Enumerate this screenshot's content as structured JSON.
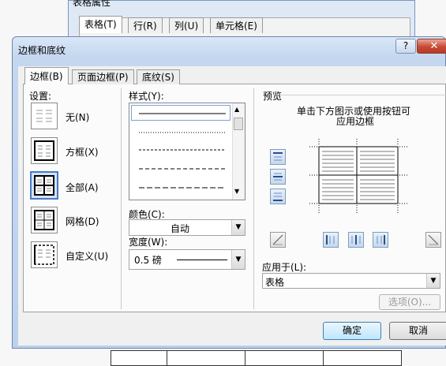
{
  "back_dialog": {
    "title": "表格属性",
    "tabs": [
      "表格(T)",
      "行(R)",
      "列(U)",
      "单元格(E)"
    ]
  },
  "dialog": {
    "title": "边框和底纹",
    "help": "?",
    "close": "✕",
    "tabs": [
      "边框(B)",
      "页面边框(P)",
      "底纹(S)"
    ],
    "setting": {
      "heading": "设置:",
      "options": [
        {
          "label": "无(N)",
          "icon": "none-border-icon"
        },
        {
          "label": "方框(X)",
          "icon": "box-border-icon"
        },
        {
          "label": "全部(A)",
          "icon": "all-borders-icon",
          "selected": true
        },
        {
          "label": "网格(D)",
          "icon": "grid-border-icon"
        },
        {
          "label": "自定义(U)",
          "icon": "custom-border-icon"
        }
      ]
    },
    "style": {
      "heading": "样式(Y):",
      "line_styles": [
        "solid",
        "dotted",
        "dash-small",
        "dash",
        "dash-long"
      ]
    },
    "color": {
      "label": "颜色(C):",
      "value": "自动"
    },
    "width": {
      "label": "宽度(W):",
      "value": "0.5 磅"
    },
    "preview": {
      "heading": "预览",
      "hint_line1": "单击下方图示或使用按钮可",
      "hint_line2": "应用边框"
    },
    "apply_to": {
      "label": "应用于(L):",
      "value": "表格"
    },
    "options_button": "选项(O)...",
    "ok_button": "确定",
    "cancel_button": "取消"
  }
}
